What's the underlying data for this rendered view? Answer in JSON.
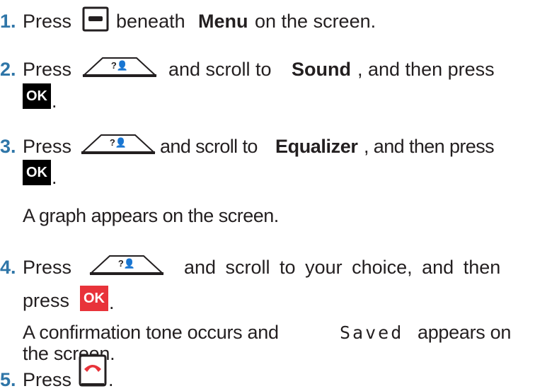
{
  "steps": [
    {
      "number": "1.",
      "pre": "Press",
      "mid": "beneath",
      "bold": "Menu",
      "post": "on the screen.",
      "icon": "menu-softkey-icon"
    },
    {
      "number": "2.",
      "pre": "Press",
      "mid": "and scroll to",
      "bold": "Sound",
      "post": ", and then press",
      "icon": "navigation-key-icon",
      "ok": "OK"
    },
    {
      "number": "3.",
      "pre": "Press",
      "mid": "and scroll to",
      "bold": "Equalizer",
      "post": ", and then press",
      "icon": "navigation-key-icon",
      "ok": "OK",
      "note": "A graph appears on the screen."
    },
    {
      "number": "4.",
      "pre": "Press",
      "mid": "and scroll to your choice, and then",
      "post": "press",
      "icon": "navigation-key-icon",
      "ok": "OK",
      "note_a": "A confirmation tone occurs and",
      "note_saved": "Saved",
      "note_b": "appears on",
      "note_c": "the screen."
    },
    {
      "number": "5.",
      "pre": "Press",
      "icon": "end-call-key-icon"
    }
  ],
  "period": "."
}
